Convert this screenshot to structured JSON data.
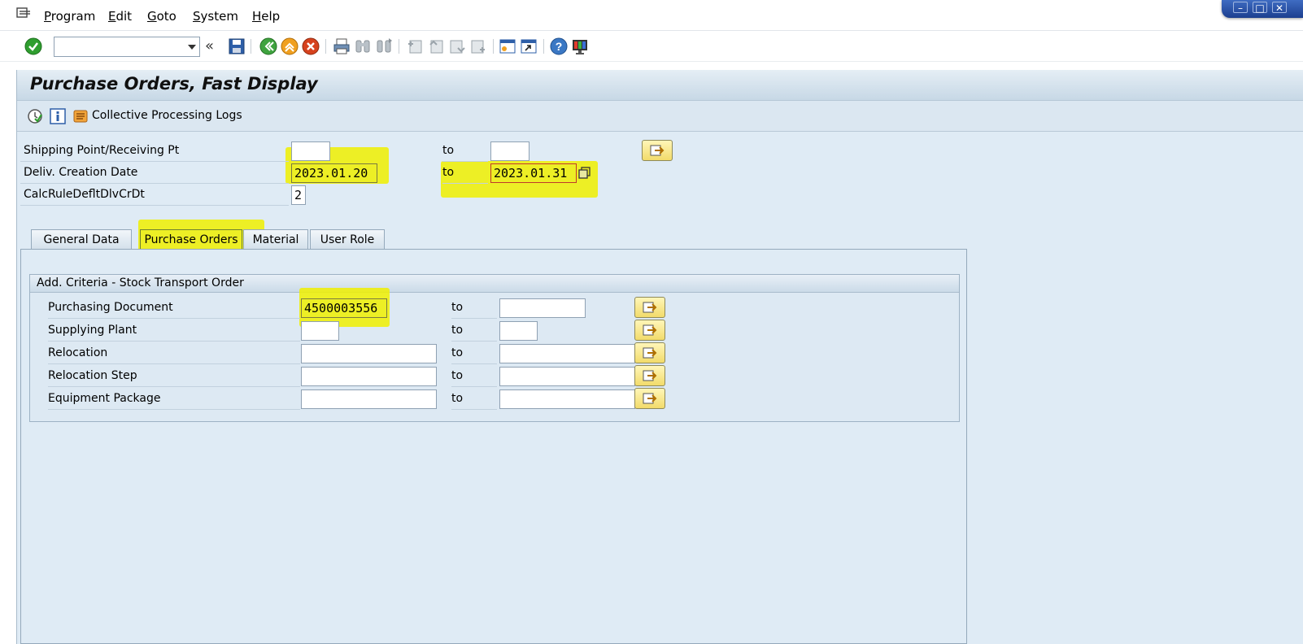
{
  "menu": {
    "items": [
      {
        "label_ul": "P",
        "label_rest": "rogram"
      },
      {
        "label_ul": "E",
        "label_rest": "dit"
      },
      {
        "label_ul": "G",
        "label_rest": "oto"
      },
      {
        "label_ul": "S",
        "label_rest": "ystem"
      },
      {
        "label_ul": "H",
        "label_rest": "elp"
      }
    ]
  },
  "toolbar": {
    "command_value": ""
  },
  "title": "Purchase Orders, Fast Display",
  "app_toolbar": {
    "collective_logs_label": "Collective Processing Logs"
  },
  "selection": {
    "shipping_point_label": "Shipping Point/Receiving Pt",
    "shipping_point_from": "",
    "shipping_point_to": "",
    "deliv_date_label": "Deliv. Creation Date",
    "deliv_date_from": "2023.01.20",
    "deliv_date_to": "2023.01.31",
    "calc_rule_label": "CalcRuleDefltDlvCrDt",
    "calc_rule_value": "2",
    "to_label": "to"
  },
  "tabs": [
    {
      "label": "General Data"
    },
    {
      "label": "Purchase Orders"
    },
    {
      "label": "Material"
    },
    {
      "label": "User Role"
    }
  ],
  "group": {
    "title": "Add. Criteria - Stock Transport Order",
    "rows": [
      {
        "label": "Purchasing Document",
        "from": "4500003556",
        "to": ""
      },
      {
        "label": "Supplying Plant",
        "from": "",
        "to": ""
      },
      {
        "label": "Relocation",
        "from": "",
        "to": ""
      },
      {
        "label": "Relocation Step",
        "from": "",
        "to": ""
      },
      {
        "label": "Equipment Package",
        "from": "",
        "to": ""
      }
    ]
  }
}
